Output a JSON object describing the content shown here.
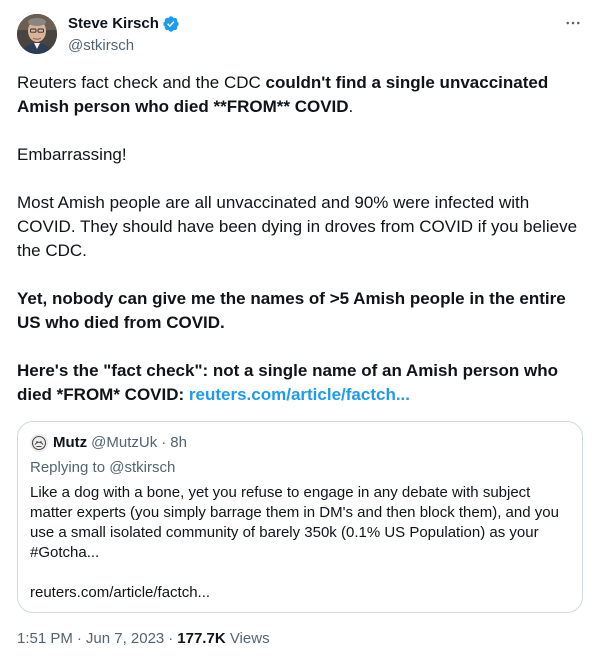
{
  "author": {
    "display_name": "Steve Kirsch",
    "handle": "@stkirsch",
    "avatar_icon": "profile-photo",
    "verified_icon": "verified-badge-icon",
    "verified_color": "#1d9bf0"
  },
  "more_icon": "more-horizontal-icon",
  "tweet": {
    "p1_a": "Reuters fact check and the CDC ",
    "p1_b": "couldn't find a single unvaccinated Amish person who died **FROM** COVID",
    "p1_c": ".",
    "p2": "Embarrassing!",
    "p3": "Most Amish people are all unvaccinated and 90% were infected with COVID. They should have been dying in droves from COVID if you believe the CDC.",
    "p4": "Yet, nobody can give me the names of >5 Amish people in the entire US who died from COVID.",
    "p5_a": "Here's the \"fact check\": not a single name of an Amish person who died *FROM* COVID: ",
    "p5_link": "reuters.com/article/factch..."
  },
  "quote": {
    "avatar_icon": "quoted-user-avatar",
    "name": "Mutz",
    "handle": "@MutzUk",
    "dot": "·",
    "time": "8h",
    "replying_prefix": "Replying to ",
    "replying_to": "@stkirsch",
    "text": "Like a dog with a bone, yet you refuse to engage in any debate with subject matter experts (you simply barrage them in DM's and then block them), and you use a small isolated community of barely 350k (0.1% US Population) as your #Gotcha...",
    "link": "reuters.com/article/factch..."
  },
  "meta": {
    "time": "1:51 PM",
    "sep1": "·",
    "date": "Jun 7, 2023",
    "sep2": "·",
    "views_count": "177.7K",
    "views_label": " Views"
  },
  "colors": {
    "text": "#0f1419",
    "secondary": "#536471",
    "link": "#1d9bf0",
    "border": "#cfd9de"
  }
}
